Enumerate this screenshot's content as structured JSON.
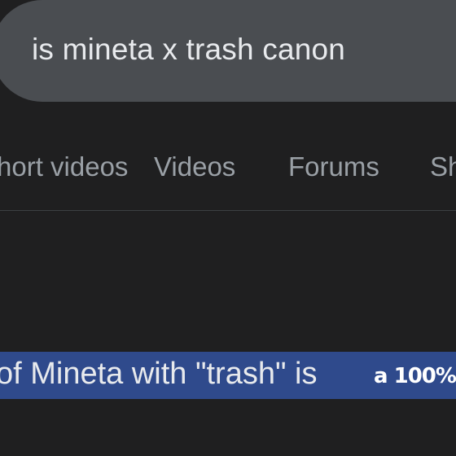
{
  "search": {
    "query": "is mineta x trash canon"
  },
  "tabs": [
    {
      "label": "Short videos"
    },
    {
      "label": "Videos"
    },
    {
      "label": "Forums"
    },
    {
      "label": "Shopping"
    }
  ],
  "result": {
    "highlighted_text": "of Mineta with \"trash\" is",
    "handwritten_note": "a 100%"
  }
}
